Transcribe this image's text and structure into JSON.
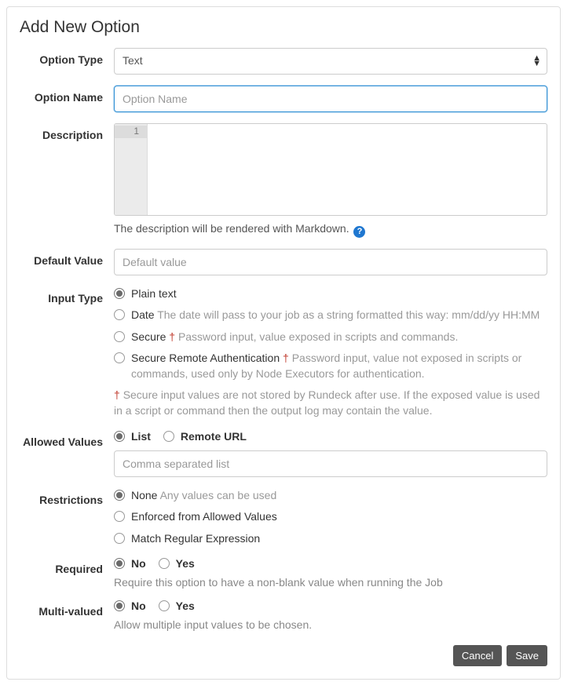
{
  "title": "Add New Option",
  "fields": {
    "optionType": {
      "label": "Option Type",
      "value": "Text"
    },
    "optionName": {
      "label": "Option Name",
      "placeholder": "Option Name",
      "value": ""
    },
    "description": {
      "label": "Description",
      "lineNumber": "1",
      "help": "The description will be rendered with Markdown.",
      "helpIcon": "?"
    },
    "defaultValue": {
      "label": "Default Value",
      "placeholder": "Default value",
      "value": ""
    },
    "inputType": {
      "label": "Input Type",
      "options": {
        "plain": {
          "label": "Plain text",
          "checked": true
        },
        "date": {
          "label": "Date",
          "hint": "The date will pass to your job as a string formatted this way: mm/dd/yy HH:MM",
          "checked": false
        },
        "secure": {
          "label": "Secure",
          "dagger": "†",
          "hint": "Password input, value exposed in scripts and commands.",
          "checked": false
        },
        "secureRemote": {
          "label": "Secure Remote Authentication",
          "dagger": "†",
          "hint": "Password input, value not exposed in scripts or commands, used only by Node Executors for authentication.",
          "checked": false
        }
      },
      "note": {
        "dagger": "†",
        "text": "Secure input values are not stored by Rundeck after use. If the exposed value is used in a script or command then the output log may contain the value."
      }
    },
    "allowedValues": {
      "label": "Allowed Values",
      "options": {
        "list": {
          "label": "List",
          "checked": true
        },
        "remote": {
          "label": "Remote URL",
          "checked": false
        }
      },
      "input": {
        "placeholder": "Comma separated list",
        "value": ""
      }
    },
    "restrictions": {
      "label": "Restrictions",
      "options": {
        "none": {
          "label": "None",
          "hint": "Any values can be used",
          "checked": true
        },
        "enforced": {
          "label": "Enforced from Allowed Values",
          "checked": false
        },
        "regex": {
          "label": "Match Regular Expression",
          "checked": false
        }
      }
    },
    "required": {
      "label": "Required",
      "options": {
        "no": {
          "label": "No",
          "checked": true
        },
        "yes": {
          "label": "Yes",
          "checked": false
        }
      },
      "help": "Require this option to have a non-blank value when running the Job"
    },
    "multiValued": {
      "label": "Multi-valued",
      "options": {
        "no": {
          "label": "No",
          "checked": true
        },
        "yes": {
          "label": "Yes",
          "checked": false
        }
      },
      "help": "Allow multiple input values to be chosen."
    }
  },
  "buttons": {
    "cancel": "Cancel",
    "save": "Save"
  }
}
